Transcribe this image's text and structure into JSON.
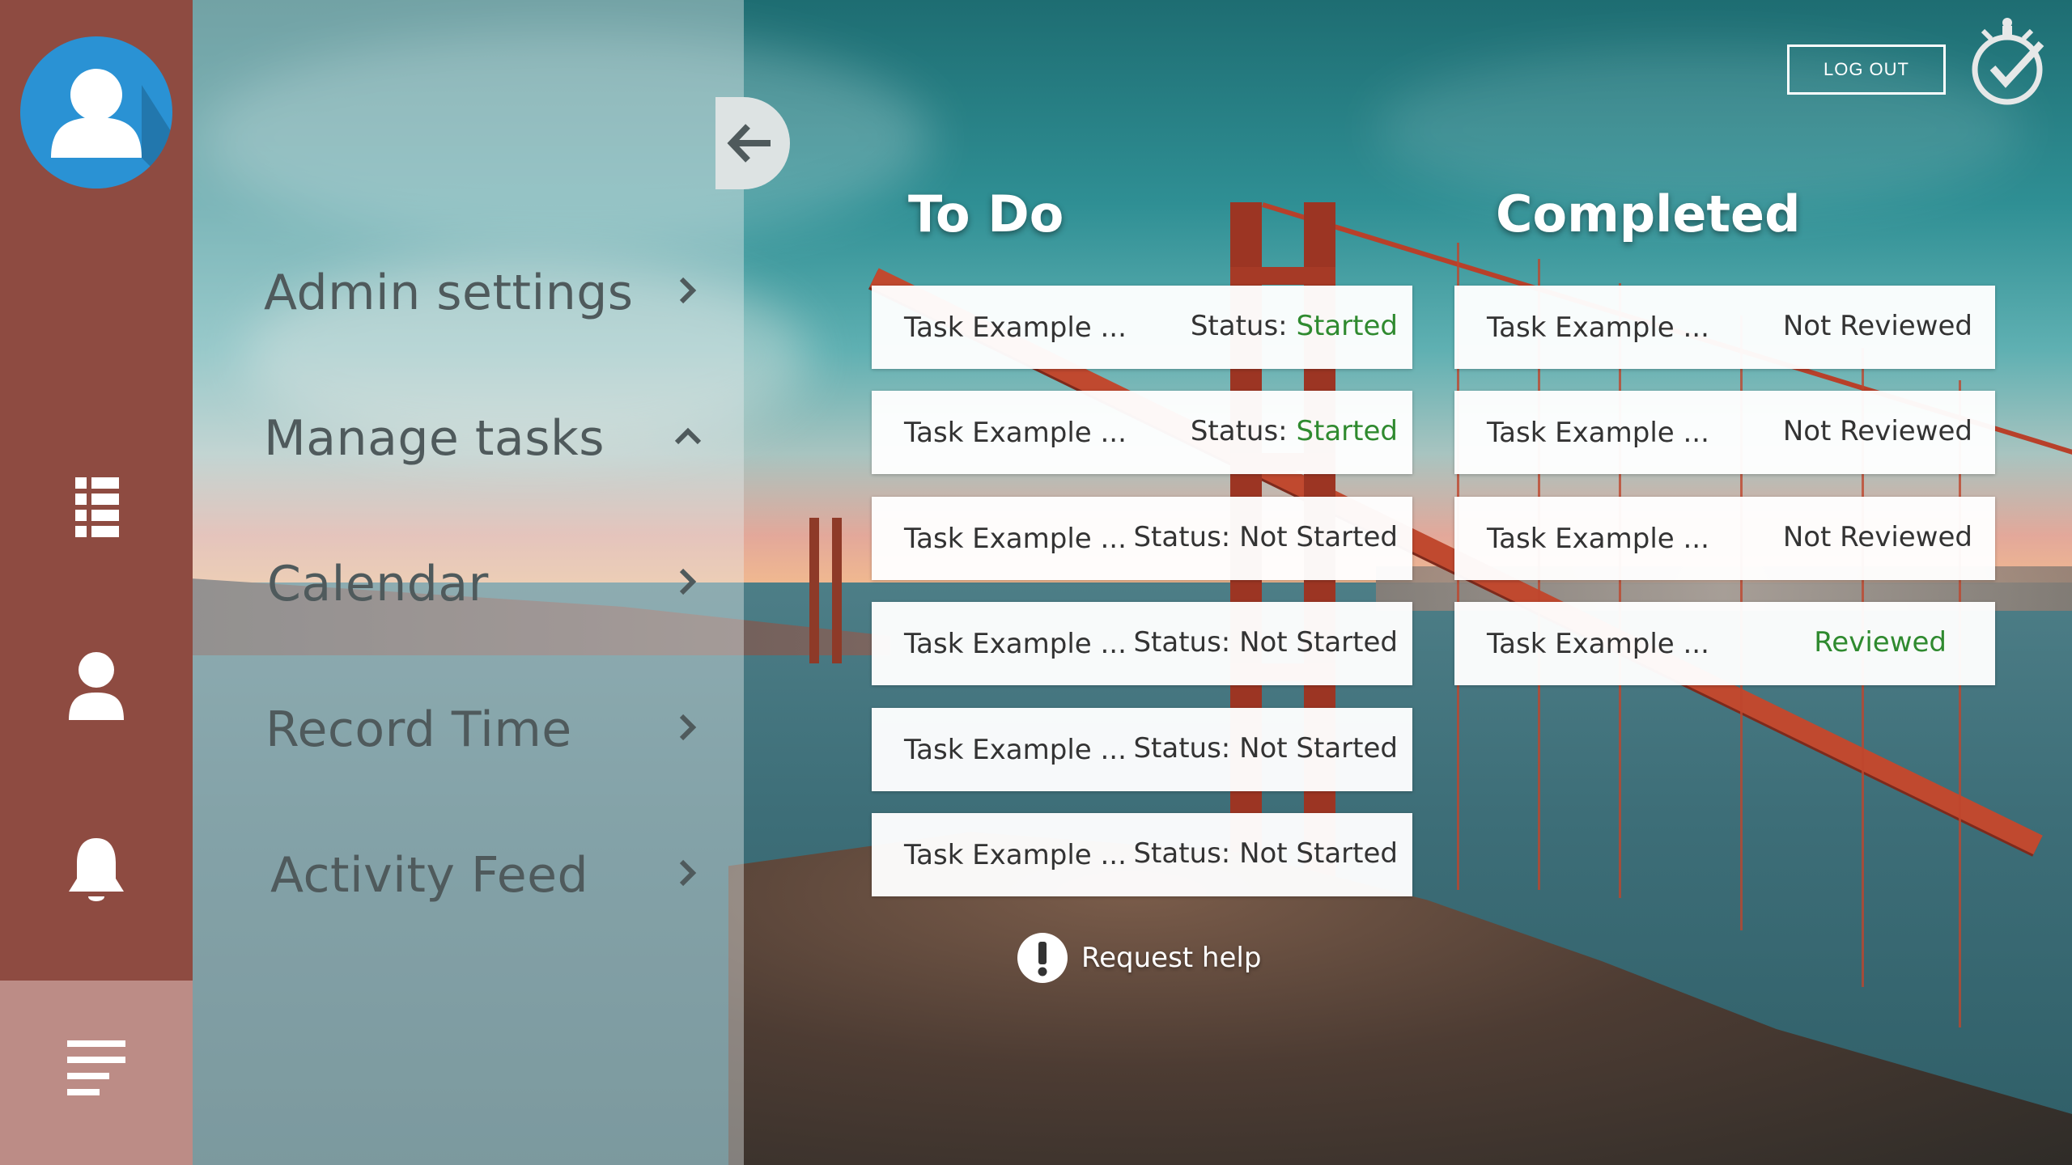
{
  "menu": {
    "items": [
      {
        "label": "Admin settings",
        "chevron": "chevron-right-icon"
      },
      {
        "label": "Manage tasks",
        "chevron": "chevron-up-icon"
      },
      {
        "label": "Calendar",
        "chevron": "chevron-right-icon"
      },
      {
        "label": "Record Time",
        "chevron": "chevron-right-icon"
      },
      {
        "label": "Activity Feed",
        "chevron": "chevron-right-icon"
      }
    ]
  },
  "rail": {
    "icons": [
      "user-avatar-icon",
      "list-icon",
      "person-icon",
      "bell-icon",
      "menu-lines-icon"
    ]
  },
  "header": {
    "logout_label": "LOG OUT"
  },
  "board": {
    "todo": {
      "title": "To Do",
      "tasks": [
        {
          "name": "Task Example ...",
          "status_prefix": "Status: ",
          "status_value": "Started"
        },
        {
          "name": "Task Example ...",
          "status_prefix": "Status: ",
          "status_value": "Started"
        },
        {
          "name": "Task Example ...",
          "status_prefix": "Status: ",
          "status_value": "Not Started"
        },
        {
          "name": "Task Example ...",
          "status_prefix": "Status: ",
          "status_value": "Not Started"
        },
        {
          "name": "Task Example ...",
          "status_prefix": "Status: ",
          "status_value": "Not Started"
        },
        {
          "name": "Task Example ...",
          "status_prefix": "Status: ",
          "status_value": "Not Started"
        }
      ]
    },
    "completed": {
      "title": "Completed",
      "tasks": [
        {
          "name": "Task Example ...",
          "status_value": "Not Reviewed"
        },
        {
          "name": "Task Example ...",
          "status_value": "Not Reviewed"
        },
        {
          "name": "Task Example ...",
          "status_value": "Not Reviewed"
        },
        {
          "name": "Task Example ...",
          "status_value": "Reviewed"
        }
      ]
    },
    "help_label": "Request help"
  },
  "colors": {
    "rail": "#8e4b41",
    "rail_active": "#bc8c86",
    "avatar_bg": "#2a92d4",
    "status_green": "#2f8a2f",
    "menu_text": "#4f5a5c"
  }
}
